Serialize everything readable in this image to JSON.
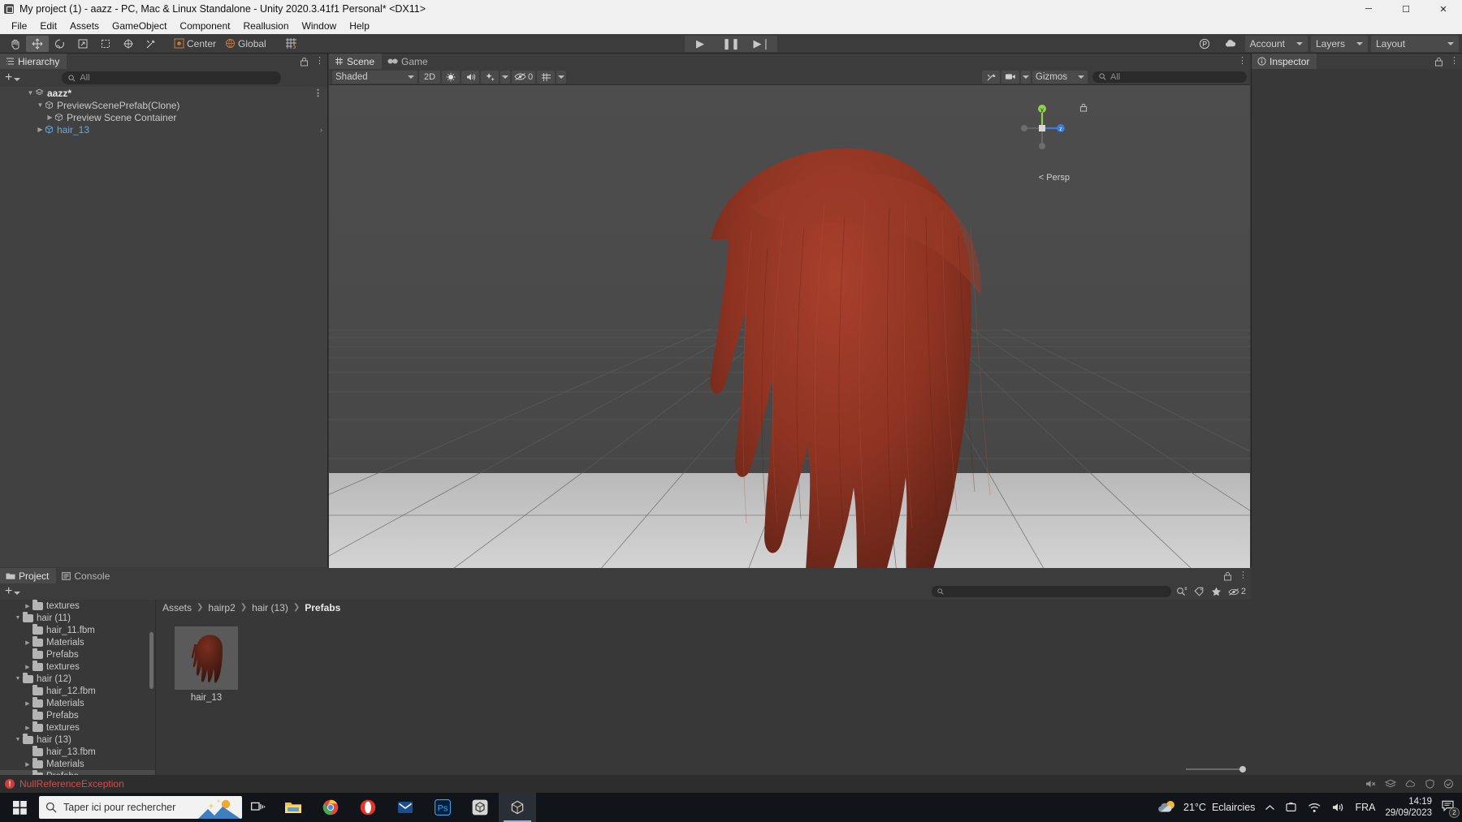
{
  "window": {
    "title": "My project (1) - aazz - PC, Mac & Linux Standalone - Unity 2020.3.41f1 Personal* <DX11>",
    "minimize": "─",
    "maximize": "☐",
    "close": "✕"
  },
  "menubar": {
    "items": [
      "File",
      "Edit",
      "Assets",
      "GameObject",
      "Component",
      "Reallusion",
      "Window",
      "Help"
    ]
  },
  "toolbar": {
    "tools": [
      {
        "name": "hand-tool",
        "glyph": "✋",
        "active": false
      },
      {
        "name": "move-tool",
        "glyph": "✥",
        "active": true
      },
      {
        "name": "rotate-tool",
        "glyph": "⟳",
        "active": false
      },
      {
        "name": "scale-tool",
        "glyph": "⤡",
        "active": false
      },
      {
        "name": "rect-tool",
        "glyph": "▣",
        "active": false
      },
      {
        "name": "transform-tool",
        "glyph": "⊕",
        "active": false
      },
      {
        "name": "custom-tool",
        "glyph": "⚒",
        "active": false
      }
    ],
    "pivot_mode": "Center",
    "pivot_rotation": "Global",
    "snap_label": "",
    "play": "▶",
    "pause": "❚❚",
    "step": "▶❘",
    "collab_icon": "collab-icon",
    "cloud_icon": "cloud-icon",
    "account": "Account",
    "layers": "Layers",
    "layout": "Layout"
  },
  "hierarchy": {
    "tab": "Hierarchy",
    "search_placeholder": "All",
    "add_label": "+",
    "rows": [
      {
        "label": "aazz*",
        "indent": 0,
        "arrow": "down",
        "icon": "scene-icon",
        "style": "scene",
        "kebab": true
      },
      {
        "label": "PreviewScenePrefab(Clone)",
        "indent": 1,
        "arrow": "down",
        "icon": "prefab-icon",
        "style": "normal",
        "kebab": false
      },
      {
        "label": "Preview Scene Container",
        "indent": 2,
        "arrow": "right",
        "icon": "prefab-icon",
        "style": "normal",
        "kebab": false
      },
      {
        "label": "hair_13",
        "indent": 1,
        "arrow": "right",
        "icon": "prefab-blue-icon",
        "style": "selected-text",
        "kebab": false,
        "rowarrow": true
      }
    ]
  },
  "scene": {
    "tabs": [
      {
        "label": "Scene",
        "icon": "scene-grid-icon",
        "active": true
      },
      {
        "label": "Game",
        "icon": "gamepad-icon",
        "active": false
      }
    ],
    "draw_mode": "Shaded",
    "two_d": "2D",
    "lighting_icon": "lighting-icon",
    "audio_icon": "audio-icon",
    "fx_icon": "fx-icon",
    "hidden_count": "0",
    "grid_icon": "grid-icon",
    "gizmos_label": "Gizmos",
    "gizmos_search_placeholder": "All",
    "perspective_label": "Persp",
    "axis_labels": {
      "y": "y",
      "z": "z"
    }
  },
  "inspector": {
    "tab": "Inspector"
  },
  "project": {
    "tabs": [
      {
        "label": "Project",
        "icon": "folder-icon",
        "active": true
      },
      {
        "label": "Console",
        "icon": "console-icon",
        "active": false
      }
    ],
    "add_label": "+",
    "search_placeholder": "",
    "breadcrumb": [
      "Assets",
      "hairp2",
      "hair (13)",
      "Prefabs"
    ],
    "filter_icons": [
      "search-filter-icon",
      "label-icon",
      "favorite-icon"
    ],
    "hidden_count": "2",
    "tree": [
      {
        "label": "textures",
        "indent": 2,
        "arrow": "right",
        "open": false,
        "partial": true
      },
      {
        "label": "hair (11)",
        "indent": 1,
        "arrow": "down",
        "open": true
      },
      {
        "label": "hair_11.fbm",
        "indent": 2,
        "arrow": "none",
        "open": false
      },
      {
        "label": "Materials",
        "indent": 2,
        "arrow": "right",
        "open": false
      },
      {
        "label": "Prefabs",
        "indent": 2,
        "arrow": "none",
        "open": false
      },
      {
        "label": "textures",
        "indent": 2,
        "arrow": "right",
        "open": false
      },
      {
        "label": "hair (12)",
        "indent": 1,
        "arrow": "down",
        "open": true
      },
      {
        "label": "hair_12.fbm",
        "indent": 2,
        "arrow": "none",
        "open": false
      },
      {
        "label": "Materials",
        "indent": 2,
        "arrow": "right",
        "open": false
      },
      {
        "label": "Prefabs",
        "indent": 2,
        "arrow": "none",
        "open": false
      },
      {
        "label": "textures",
        "indent": 2,
        "arrow": "right",
        "open": false
      },
      {
        "label": "hair (13)",
        "indent": 1,
        "arrow": "down",
        "open": true
      },
      {
        "label": "hair_13.fbm",
        "indent": 2,
        "arrow": "none",
        "open": false
      },
      {
        "label": "Materials",
        "indent": 2,
        "arrow": "right",
        "open": false
      },
      {
        "label": "Prefabs",
        "indent": 2,
        "arrow": "none",
        "open": false,
        "selected": true
      }
    ],
    "assets": [
      {
        "label": "hair_13",
        "type": "prefab-thumbnail"
      }
    ]
  },
  "status": {
    "icon": "error-icon",
    "message": "NullReferenceException",
    "right_icons": [
      "mute-icon",
      "layers-status-icon",
      "cloud-status-icon",
      "shield-status-icon",
      "check-status-icon"
    ]
  },
  "taskbar": {
    "start_icon": "windows-start-icon",
    "search_placeholder": "Taper ici pour rechercher",
    "taskview_icon": "task-view-icon",
    "apps": [
      {
        "name": "file-explorer",
        "icon": "folder-app-icon",
        "active": false
      },
      {
        "name": "chrome",
        "icon": "chrome-icon",
        "active": false
      },
      {
        "name": "opera",
        "icon": "opera-icon",
        "active": false
      },
      {
        "name": "mail",
        "icon": "mail-icon",
        "active": false
      },
      {
        "name": "photoshop",
        "icon": "photoshop-icon",
        "active": false
      },
      {
        "name": "unity-hub",
        "icon": "unity-icon",
        "active": false
      },
      {
        "name": "unity-editor",
        "icon": "unity-editor-icon",
        "active": true
      }
    ],
    "weather": {
      "temperature": "21°C",
      "condition": "Eclaircies"
    },
    "tray_icons": [
      "chevron-up-icon",
      "onedrive-icon",
      "wifi-icon",
      "volume-icon"
    ],
    "language": "FRA",
    "time": "14:19",
    "date": "29/09/2023",
    "notification_count": "2"
  },
  "colors": {
    "unity_bg": "#383838",
    "panel": "#3c3c3c",
    "selected_text": "#6ea8d8",
    "error_red": "#d84b4b",
    "hair": "#8f3322"
  }
}
